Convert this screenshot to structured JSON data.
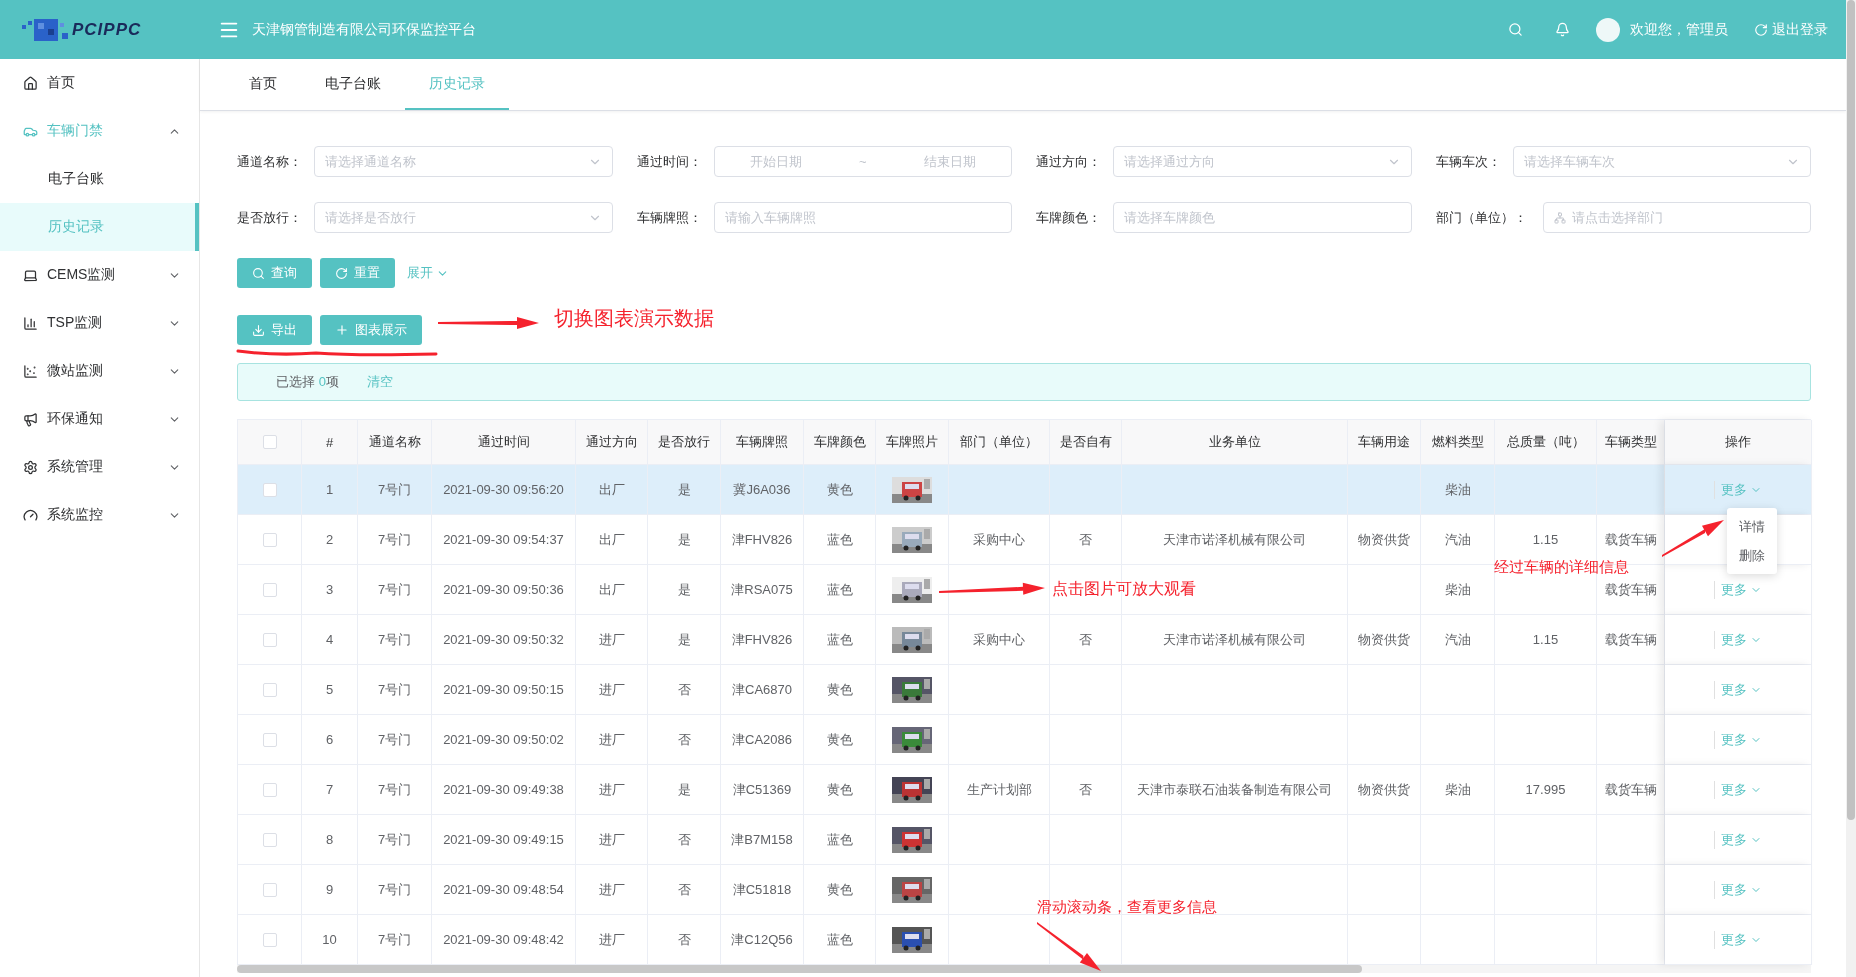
{
  "header": {
    "logo_text": "PCIPPC",
    "title": "天津钢管制造有限公司环保监控平台",
    "greeting": "欢迎您，管理员",
    "logout": "退出登录"
  },
  "sidebar": {
    "items": [
      {
        "label": "首页",
        "kind": "link"
      },
      {
        "label": "车辆门禁",
        "kind": "group",
        "expanded": true,
        "children": [
          {
            "label": "电子台账",
            "selected": false
          },
          {
            "label": "历史记录",
            "selected": true
          }
        ]
      },
      {
        "label": "CEMS监测",
        "kind": "group",
        "expanded": false
      },
      {
        "label": "TSP监测",
        "kind": "group",
        "expanded": false
      },
      {
        "label": "微站监测",
        "kind": "group",
        "expanded": false
      },
      {
        "label": "环保通知",
        "kind": "group",
        "expanded": false
      },
      {
        "label": "系统管理",
        "kind": "group",
        "expanded": false
      },
      {
        "label": "系统监控",
        "kind": "group",
        "expanded": false
      }
    ]
  },
  "tabs": [
    {
      "label": "首页",
      "selected": false
    },
    {
      "label": "电子台账",
      "selected": false
    },
    {
      "label": "历史记录",
      "selected": true
    }
  ],
  "filters": [
    {
      "label": "通道名称：",
      "kind": "select",
      "placeholder": "请选择通道名称"
    },
    {
      "label": "通过时间：",
      "kind": "daterange",
      "start_placeholder": "开始日期",
      "separator": "~",
      "end_placeholder": "结束日期"
    },
    {
      "label": "通过方向：",
      "kind": "select",
      "placeholder": "请选择通过方向"
    },
    {
      "label": "车辆车次：",
      "kind": "select",
      "placeholder": "请选择车辆车次"
    },
    {
      "label": "是否放行：",
      "kind": "select",
      "placeholder": "请选择是否放行"
    },
    {
      "label": "车辆牌照：",
      "kind": "input",
      "placeholder": "请输入车辆牌照"
    },
    {
      "label": "车牌颜色：",
      "kind": "input",
      "placeholder": "请选择车牌颜色"
    },
    {
      "label": "部门（单位）：",
      "kind": "tree",
      "placeholder": "请点击选择部门"
    }
  ],
  "search_buttons": [
    {
      "label": "查询"
    },
    {
      "label": "重置"
    }
  ],
  "expand_link": "展开",
  "actions": [
    {
      "label": "导出"
    },
    {
      "label": "图表展示"
    }
  ],
  "selection": {
    "prefix": "已选择 ",
    "count": "0",
    "suffix": "项",
    "clear": "清空"
  },
  "table": {
    "all_checked": false,
    "columns": [
      "#",
      "通道名称",
      "通过时间",
      "通过方向",
      "是否放行",
      "车辆牌照",
      "车牌颜色",
      "车牌照片",
      "部门（单位）",
      "是否自有",
      "业务单位",
      "车辆用途",
      "燃料类型",
      "总质量（吨）",
      "车辆类型",
      "操作"
    ],
    "rows": [
      {
        "checked": false,
        "highlighted": true,
        "index": "1",
        "gate": "7号门",
        "time": "2021-09-30 09:56:20",
        "direction": "出厂",
        "released": "是",
        "plate": "冀J6A036",
        "plate_color": "黄色",
        "fuel": "柴油",
        "action": "更多"
      },
      {
        "checked": false,
        "highlighted": false,
        "index": "2",
        "gate": "7号门",
        "time": "2021-09-30 09:54:37",
        "direction": "出厂",
        "released": "是",
        "plate": "津FHV826",
        "plate_color": "蓝色",
        "department": "采购中心",
        "own": "否",
        "company": "天津市诺泽机械有限公司",
        "usage": "物资供货",
        "fuel": "汽油",
        "weight": "1.15",
        "vehicle_type": "载货车辆",
        "menu": [
          "详情",
          "删除"
        ]
      },
      {
        "checked": false,
        "highlighted": false,
        "index": "3",
        "gate": "7号门",
        "time": "2021-09-30 09:50:36",
        "direction": "出厂",
        "released": "是",
        "plate": "津RSA075",
        "plate_color": "蓝色",
        "fuel": "柴油",
        "vehicle_type": "载货车辆",
        "action": "更多"
      },
      {
        "checked": false,
        "highlighted": false,
        "index": "4",
        "gate": "7号门",
        "time": "2021-09-30 09:50:32",
        "direction": "进厂",
        "released": "是",
        "plate": "津FHV826",
        "plate_color": "蓝色",
        "department": "采购中心",
        "own": "否",
        "company": "天津市诺泽机械有限公司",
        "usage": "物资供货",
        "fuel": "汽油",
        "weight": "1.15",
        "vehicle_type": "载货车辆",
        "action": "更多"
      },
      {
        "checked": false,
        "highlighted": false,
        "index": "5",
        "gate": "7号门",
        "time": "2021-09-30 09:50:15",
        "direction": "进厂",
        "released": "否",
        "plate": "津CA6870",
        "plate_color": "黄色",
        "action": "更多"
      },
      {
        "checked": false,
        "highlighted": false,
        "index": "6",
        "gate": "7号门",
        "time": "2021-09-30 09:50:02",
        "direction": "进厂",
        "released": "否",
        "plate": "津CA2086",
        "plate_color": "黄色",
        "action": "更多"
      },
      {
        "checked": false,
        "highlighted": false,
        "index": "7",
        "gate": "7号门",
        "time": "2021-09-30 09:49:38",
        "direction": "进厂",
        "released": "是",
        "plate": "津C51369",
        "plate_color": "黄色",
        "department": "生产计划部",
        "own": "否",
        "company": "天津市泰联石油装备制造有限公司",
        "usage": "物资供货",
        "fuel": "柴油",
        "weight": "17.995",
        "vehicle_type": "载货车辆",
        "action": "更多"
      },
      {
        "checked": false,
        "highlighted": false,
        "index": "8",
        "gate": "7号门",
        "time": "2021-09-30 09:49:15",
        "direction": "进厂",
        "released": "否",
        "plate": "津B7M158",
        "plate_color": "蓝色",
        "action": "更多"
      },
      {
        "checked": false,
        "highlighted": false,
        "index": "9",
        "gate": "7号门",
        "time": "2021-09-30 09:48:54",
        "direction": "进厂",
        "released": "否",
        "plate": "津C51818",
        "plate_color": "黄色",
        "action": "更多"
      },
      {
        "checked": false,
        "highlighted": false,
        "index": "10",
        "gate": "7号门",
        "time": "2021-09-30 09:48:42",
        "direction": "进厂",
        "released": "否",
        "plate": "津C12Q56",
        "plate_color": "蓝色",
        "action": "更多"
      }
    ]
  },
  "annotations": [
    {
      "text": "切换图表演示数据"
    },
    {
      "text": "点击图片可放大观看"
    },
    {
      "text": "经过车辆的详细信息"
    },
    {
      "text": "滑动滚动条，查看更多信息"
    }
  ]
}
